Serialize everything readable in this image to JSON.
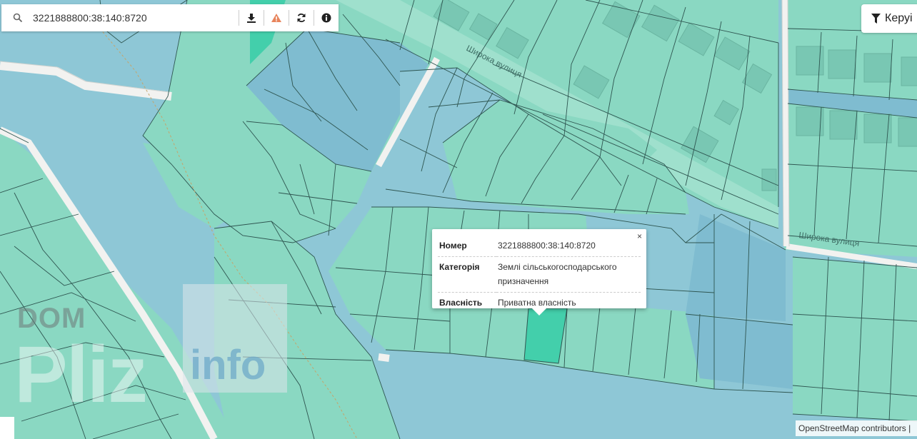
{
  "search": {
    "value": "3221888800:38:140:8720",
    "icons": [
      "search-icon",
      "download-icon",
      "warning-icon",
      "refresh-icon",
      "info-icon"
    ]
  },
  "filter_button": {
    "label": "Керуі",
    "icon": "filter-icon"
  },
  "map": {
    "street_labels": [
      "Широка вулиця",
      "Широка вулиця"
    ],
    "colors": {
      "parcel_green": "#8ad8c2",
      "parcel_blue": "#8ec7d6",
      "parcel_blue_dark": "#7fbcd0",
      "selected_parcel": "#43cfab",
      "building": "#79c7b3",
      "road": "#ffffff",
      "parcel_line": "#2e5550"
    }
  },
  "popup": {
    "close_label": "×",
    "rows": [
      {
        "key": "Номер",
        "value": "3221888800:38:140:8720"
      },
      {
        "key": "Категорія",
        "value": "Землі сільськогосподарського призначення"
      },
      {
        "key": "Власність",
        "value": "Приватна власність"
      }
    ]
  },
  "watermark": {
    "dom": "DOM",
    "brand": "Pliz",
    "suffix": "info"
  },
  "attribution": "OpenStreetMap contributors |"
}
